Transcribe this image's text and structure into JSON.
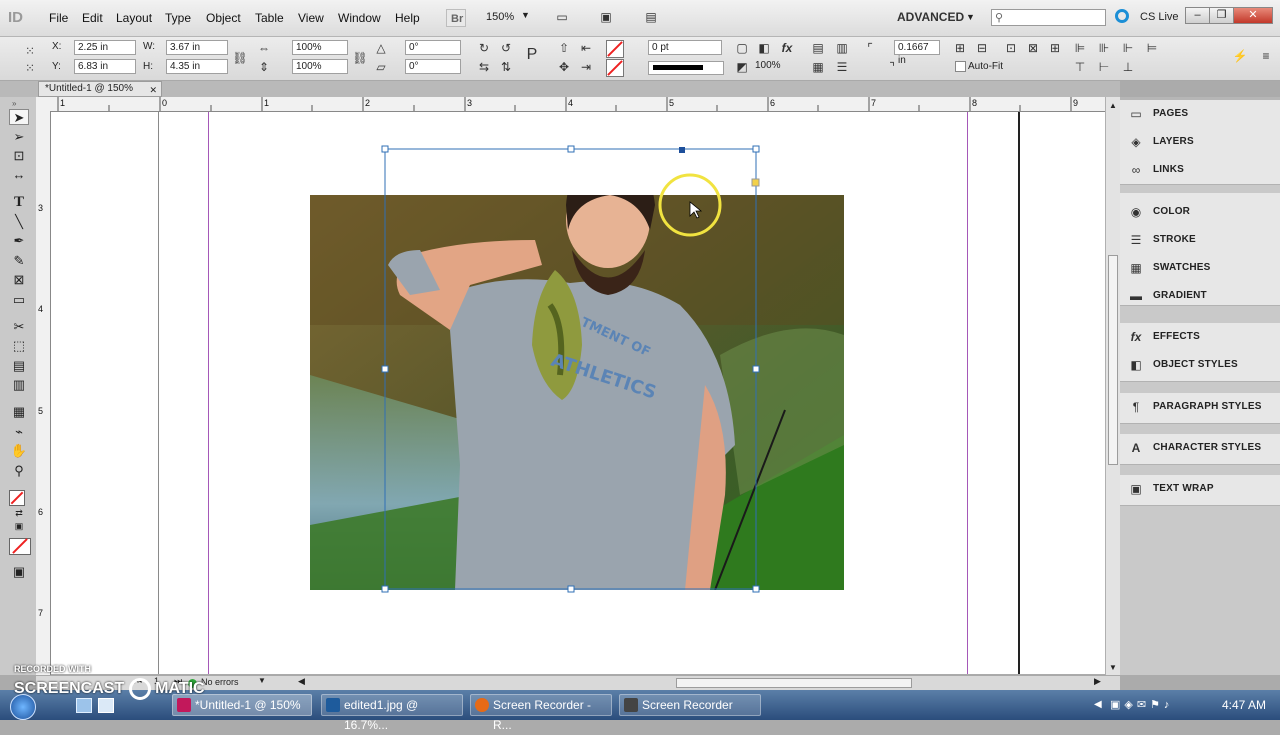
{
  "app": {
    "logo": "ID"
  },
  "menu": [
    "File",
    "Edit",
    "Layout",
    "Type",
    "Object",
    "Table",
    "View",
    "Window",
    "Help"
  ],
  "toolbar_top": {
    "bridge": "Br",
    "zoom": "150%",
    "workspace": "ADVANCED",
    "cslive": "CS Live"
  },
  "window_buttons": [
    "‒",
    "❐",
    "✕"
  ],
  "control": {
    "x_label": "X:",
    "x_value": "2.25 in",
    "y_label": "Y:",
    "y_value": "6.83 in",
    "w_label": "W:",
    "w_value": "3.67 in",
    "h_label": "H:",
    "h_value": "4.35 in",
    "scale_x": "100%",
    "scale_y": "100%",
    "rotate": "0°",
    "shear": "0°",
    "stroke_weight": "0 pt",
    "opacity": "100%",
    "offset": "0.1667 in",
    "autofit": "Auto-Fit"
  },
  "document_tab": {
    "title": "*Untitled-1 @ 150%",
    "close": "✕"
  },
  "ruler_top": [
    "1",
    "0",
    "1",
    "2",
    "3",
    "4",
    "5",
    "6",
    "7",
    "8",
    "9"
  ],
  "ruler_left": [
    "3",
    "4",
    "5",
    "6",
    "7"
  ],
  "panels": [
    {
      "label": "PAGES",
      "icon": "pages-icon"
    },
    {
      "label": "LAYERS",
      "icon": "layers-icon"
    },
    {
      "label": "LINKS",
      "icon": "links-icon"
    },
    {
      "label": "COLOR",
      "icon": "color-icon"
    },
    {
      "label": "STROKE",
      "icon": "stroke-icon"
    },
    {
      "label": "SWATCHES",
      "icon": "swatches-icon"
    },
    {
      "label": "GRADIENT",
      "icon": "gradient-icon"
    },
    {
      "label": "EFFECTS",
      "icon": "effects-icon"
    },
    {
      "label": "OBJECT STYLES",
      "icon": "object-styles-icon"
    },
    {
      "label": "PARAGRAPH STYLES",
      "icon": "paragraph-styles-icon"
    },
    {
      "label": "CHARACTER STYLES",
      "icon": "character-styles-icon"
    },
    {
      "label": "TEXT WRAP",
      "icon": "text-wrap-icon"
    }
  ],
  "status": {
    "page": "1",
    "preflight": "No errors"
  },
  "taskbar": {
    "items": [
      "*Untitled-1 @ 150%",
      "edited1.jpg @ 16.7%...",
      "Screen Recorder - R...",
      "Screen Recorder"
    ],
    "clock": "4:47 AM"
  },
  "watermark": {
    "line1": "RECORDED WITH",
    "line2": "SCREENCAST",
    "line3": "MATIC"
  },
  "colors": {
    "frame": "#2f6fb5",
    "margin": "#a558b8",
    "accent": "#1c8fd6"
  }
}
